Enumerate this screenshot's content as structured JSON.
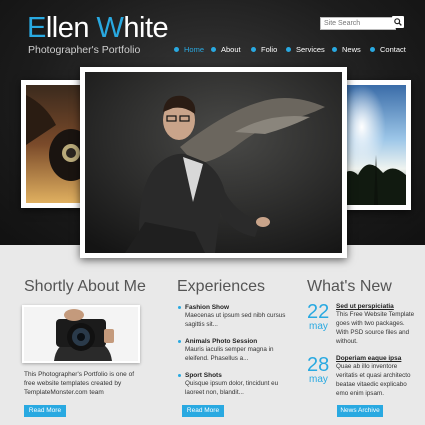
{
  "site": {
    "title_initial_1": "E",
    "title_rest_1": "llen ",
    "title_initial_2": "W",
    "title_rest_2": "hite",
    "subtitle": "Photographer's Portfolio"
  },
  "search": {
    "placeholder": "Site Search"
  },
  "nav": [
    {
      "label": "Home",
      "active": true
    },
    {
      "label": "About"
    },
    {
      "label": "Folio"
    },
    {
      "label": "Services"
    },
    {
      "label": "News"
    },
    {
      "label": "Contact"
    }
  ],
  "about": {
    "title": "Shortly About Me",
    "text": "This Photographer's Portfolio is one of free website templates created by TemplateMonster.com team",
    "button": "Read More"
  },
  "experiences": {
    "title": "Experiences",
    "items": [
      {
        "title": "Fashion Show",
        "desc": "Maecenas ut ipsum sed nibh cursus sagittis sit..."
      },
      {
        "title": "Animals Photo Session",
        "desc": "Mauris iaculis semper magna in eleifend. Phasellus a..."
      },
      {
        "title": "Sport Shots",
        "desc": "Quisque ipsum dolor, tincidunt eu laoreet non, blandit..."
      }
    ],
    "button": "Read More"
  },
  "news": {
    "title": "What's New",
    "items": [
      {
        "day": "22",
        "month": "may",
        "title": "Sed ut perspiciatia",
        "text": "This Free Website Template goes with two packages. With PSD source files and without."
      },
      {
        "day": "28",
        "month": "may",
        "title": "Doperiam eaque ipsa",
        "text": "Quae ab illo inventore veritatis et quasi architecto beatae vitaedic explicabo emo enim ipsam."
      }
    ],
    "button": "News Archive"
  },
  "colors": {
    "accent": "#29a9e1",
    "header_bg": "#1c1c1c"
  }
}
